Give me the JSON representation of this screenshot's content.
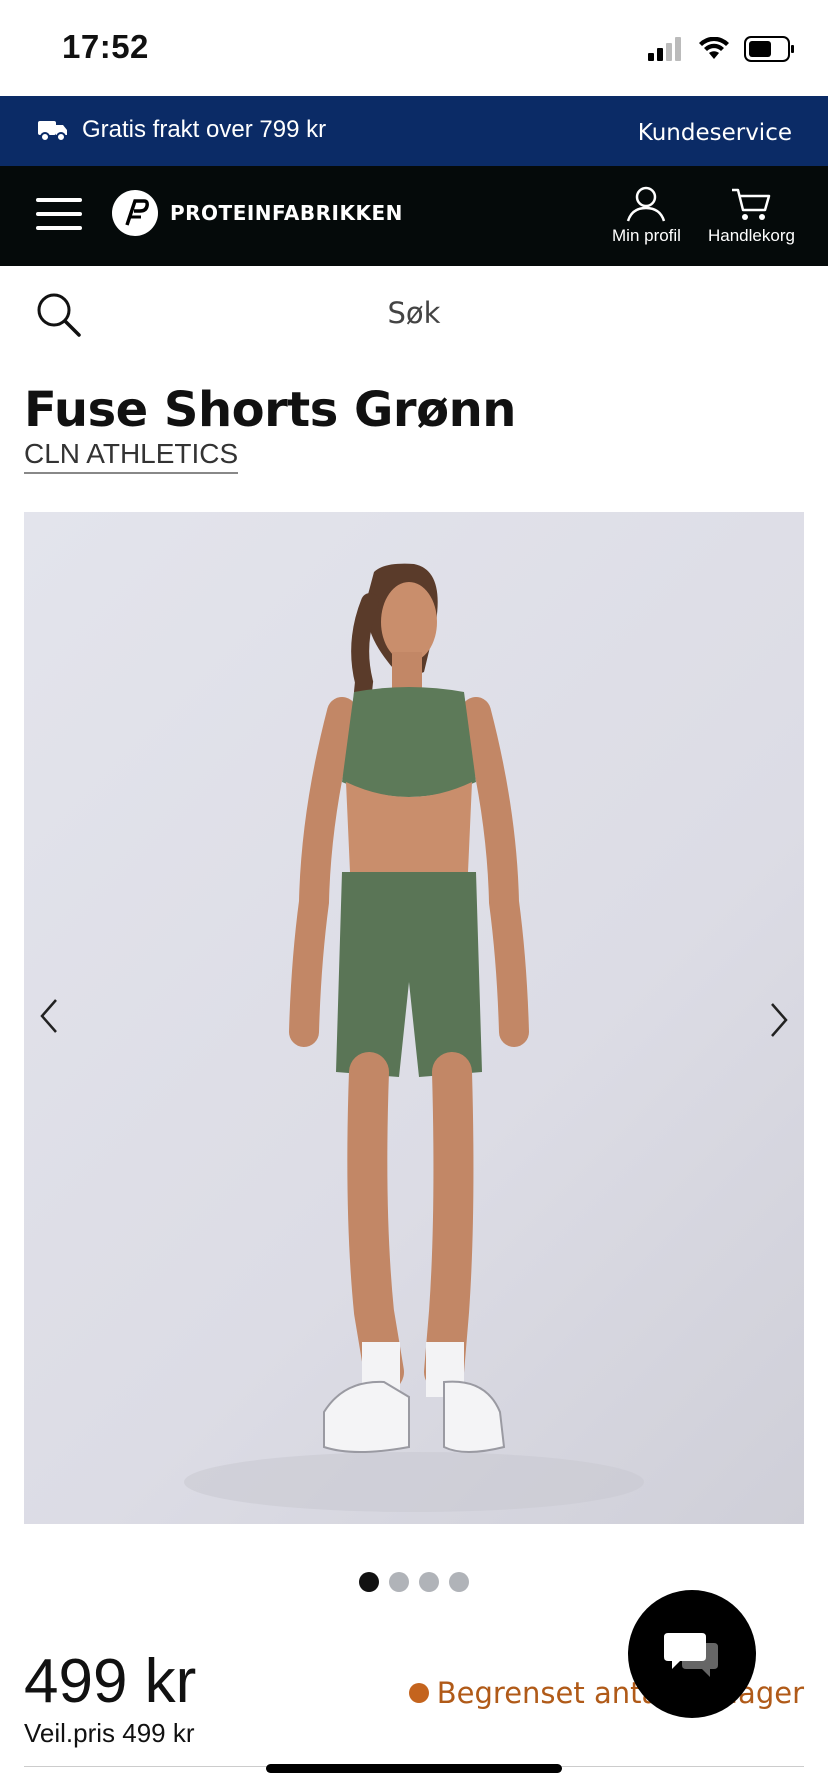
{
  "status": {
    "time": "17:52"
  },
  "topbar": {
    "free_shipping": "Gratis frakt over 799 kr",
    "customer_service": "Kundeservice",
    "bg": "#0b2b66"
  },
  "header": {
    "logo_text": "PROTEINFABRIKKEN",
    "profile_label": "Min profil",
    "cart_label": "Handlekorg"
  },
  "search": {
    "placeholder": "Søk"
  },
  "product": {
    "title": "Fuse Shorts Grønn",
    "brand": "CLN ATHLETICS",
    "price": "499 kr",
    "rrp": "Veil.pris 499 kr",
    "stock": "Begrenset antall på lager",
    "stock_color": "#c4641e"
  },
  "gallery": {
    "image_count": 4,
    "active_index": 0
  }
}
